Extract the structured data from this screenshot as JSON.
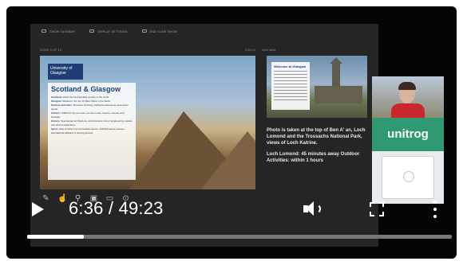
{
  "player": {
    "current_time": "6:36",
    "total_time": "49:23",
    "separator": " / ",
    "progress_fraction": 0.134,
    "colors": {
      "progress": "#ffffff",
      "track": "#777777",
      "background": "#050505"
    }
  },
  "presenter": {
    "toolbar": [
      {
        "label": "SHOW TASKBAR",
        "icon": "taskbar-icon"
      },
      {
        "label": "DISPLAY SETTINGS",
        "icon": "display-icon"
      },
      {
        "label": "END SLIDE SHOW",
        "icon": "end-show-icon"
      }
    ],
    "slide_counter": "SLIDE 9 OF 13",
    "slide_clock": "0:09:14",
    "next_slide_label": "Next slide",
    "current_slide": {
      "logo": "University of Glasgow",
      "title": "Scotland & Glasgow",
      "lines": [
        {
          "label": "Scotland:",
          "text": "Voted the best Scottish country in the world"
        },
        {
          "label": "Glasgow:",
          "text": "Ranked in the top 10 Best Cities in the World"
        },
        {
          "label": "Outdoor Activities:",
          "text": "Mountain climbing, highlands adventures and winter sports"
        },
        {
          "label": "Culture:",
          "text": "UNESCO city of music, art, live music, theatre, comedy and festivals"
        },
        {
          "label": "History:",
          "text": "Spectacular architecture, world-famous rock of engineering, castles and ancient attractions"
        },
        {
          "label": "Sport:",
          "text": "Host of 2014 Commonwealth Games, 2018 European Games, international athletics & Gaming Events"
        }
      ]
    },
    "next_slide": {
      "title": "Welcome to Glasgow"
    },
    "notes": [
      "Photo is taken at the top of Ben A' an, Loch Lomond and the Trossachs National Park, views of Loch Katrine.",
      "Loch Lomond: 45 minutes away Outdoor Activities: within 1 hours"
    ],
    "tools": [
      "pen-icon",
      "laser-icon",
      "zoom-icon",
      "screen-icon",
      "subtitles-icon",
      "more-options-icon"
    ]
  },
  "webcam": {
    "logo_text": "unitrog"
  },
  "icons": {
    "play": "play-icon",
    "volume": "volume-icon",
    "fullscreen": "fullscreen-icon",
    "more": "more-vertical-icon"
  }
}
